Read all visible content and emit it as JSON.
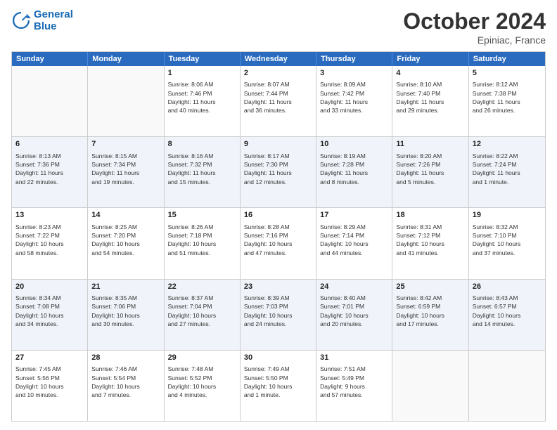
{
  "logo": {
    "line1": "General",
    "line2": "Blue"
  },
  "title": "October 2024",
  "location": "Epiniac, France",
  "header_days": [
    "Sunday",
    "Monday",
    "Tuesday",
    "Wednesday",
    "Thursday",
    "Friday",
    "Saturday"
  ],
  "rows": [
    [
      {
        "day": "",
        "lines": []
      },
      {
        "day": "",
        "lines": []
      },
      {
        "day": "1",
        "lines": [
          "Sunrise: 8:06 AM",
          "Sunset: 7:46 PM",
          "Daylight: 11 hours",
          "and 40 minutes."
        ]
      },
      {
        "day": "2",
        "lines": [
          "Sunrise: 8:07 AM",
          "Sunset: 7:44 PM",
          "Daylight: 11 hours",
          "and 36 minutes."
        ]
      },
      {
        "day": "3",
        "lines": [
          "Sunrise: 8:09 AM",
          "Sunset: 7:42 PM",
          "Daylight: 11 hours",
          "and 33 minutes."
        ]
      },
      {
        "day": "4",
        "lines": [
          "Sunrise: 8:10 AM",
          "Sunset: 7:40 PM",
          "Daylight: 11 hours",
          "and 29 minutes."
        ]
      },
      {
        "day": "5",
        "lines": [
          "Sunrise: 8:12 AM",
          "Sunset: 7:38 PM",
          "Daylight: 11 hours",
          "and 26 minutes."
        ]
      }
    ],
    [
      {
        "day": "6",
        "lines": [
          "Sunrise: 8:13 AM",
          "Sunset: 7:36 PM",
          "Daylight: 11 hours",
          "and 22 minutes."
        ]
      },
      {
        "day": "7",
        "lines": [
          "Sunrise: 8:15 AM",
          "Sunset: 7:34 PM",
          "Daylight: 11 hours",
          "and 19 minutes."
        ]
      },
      {
        "day": "8",
        "lines": [
          "Sunrise: 8:16 AM",
          "Sunset: 7:32 PM",
          "Daylight: 11 hours",
          "and 15 minutes."
        ]
      },
      {
        "day": "9",
        "lines": [
          "Sunrise: 8:17 AM",
          "Sunset: 7:30 PM",
          "Daylight: 11 hours",
          "and 12 minutes."
        ]
      },
      {
        "day": "10",
        "lines": [
          "Sunrise: 8:19 AM",
          "Sunset: 7:28 PM",
          "Daylight: 11 hours",
          "and 8 minutes."
        ]
      },
      {
        "day": "11",
        "lines": [
          "Sunrise: 8:20 AM",
          "Sunset: 7:26 PM",
          "Daylight: 11 hours",
          "and 5 minutes."
        ]
      },
      {
        "day": "12",
        "lines": [
          "Sunrise: 8:22 AM",
          "Sunset: 7:24 PM",
          "Daylight: 11 hours",
          "and 1 minute."
        ]
      }
    ],
    [
      {
        "day": "13",
        "lines": [
          "Sunrise: 8:23 AM",
          "Sunset: 7:22 PM",
          "Daylight: 10 hours",
          "and 58 minutes."
        ]
      },
      {
        "day": "14",
        "lines": [
          "Sunrise: 8:25 AM",
          "Sunset: 7:20 PM",
          "Daylight: 10 hours",
          "and 54 minutes."
        ]
      },
      {
        "day": "15",
        "lines": [
          "Sunrise: 8:26 AM",
          "Sunset: 7:18 PM",
          "Daylight: 10 hours",
          "and 51 minutes."
        ]
      },
      {
        "day": "16",
        "lines": [
          "Sunrise: 8:28 AM",
          "Sunset: 7:16 PM",
          "Daylight: 10 hours",
          "and 47 minutes."
        ]
      },
      {
        "day": "17",
        "lines": [
          "Sunrise: 8:29 AM",
          "Sunset: 7:14 PM",
          "Daylight: 10 hours",
          "and 44 minutes."
        ]
      },
      {
        "day": "18",
        "lines": [
          "Sunrise: 8:31 AM",
          "Sunset: 7:12 PM",
          "Daylight: 10 hours",
          "and 41 minutes."
        ]
      },
      {
        "day": "19",
        "lines": [
          "Sunrise: 8:32 AM",
          "Sunset: 7:10 PM",
          "Daylight: 10 hours",
          "and 37 minutes."
        ]
      }
    ],
    [
      {
        "day": "20",
        "lines": [
          "Sunrise: 8:34 AM",
          "Sunset: 7:08 PM",
          "Daylight: 10 hours",
          "and 34 minutes."
        ]
      },
      {
        "day": "21",
        "lines": [
          "Sunrise: 8:35 AM",
          "Sunset: 7:06 PM",
          "Daylight: 10 hours",
          "and 30 minutes."
        ]
      },
      {
        "day": "22",
        "lines": [
          "Sunrise: 8:37 AM",
          "Sunset: 7:04 PM",
          "Daylight: 10 hours",
          "and 27 minutes."
        ]
      },
      {
        "day": "23",
        "lines": [
          "Sunrise: 8:39 AM",
          "Sunset: 7:03 PM",
          "Daylight: 10 hours",
          "and 24 minutes."
        ]
      },
      {
        "day": "24",
        "lines": [
          "Sunrise: 8:40 AM",
          "Sunset: 7:01 PM",
          "Daylight: 10 hours",
          "and 20 minutes."
        ]
      },
      {
        "day": "25",
        "lines": [
          "Sunrise: 8:42 AM",
          "Sunset: 6:59 PM",
          "Daylight: 10 hours",
          "and 17 minutes."
        ]
      },
      {
        "day": "26",
        "lines": [
          "Sunrise: 8:43 AM",
          "Sunset: 6:57 PM",
          "Daylight: 10 hours",
          "and 14 minutes."
        ]
      }
    ],
    [
      {
        "day": "27",
        "lines": [
          "Sunrise: 7:45 AM",
          "Sunset: 5:56 PM",
          "Daylight: 10 hours",
          "and 10 minutes."
        ]
      },
      {
        "day": "28",
        "lines": [
          "Sunrise: 7:46 AM",
          "Sunset: 5:54 PM",
          "Daylight: 10 hours",
          "and 7 minutes."
        ]
      },
      {
        "day": "29",
        "lines": [
          "Sunrise: 7:48 AM",
          "Sunset: 5:52 PM",
          "Daylight: 10 hours",
          "and 4 minutes."
        ]
      },
      {
        "day": "30",
        "lines": [
          "Sunrise: 7:49 AM",
          "Sunset: 5:50 PM",
          "Daylight: 10 hours",
          "and 1 minute."
        ]
      },
      {
        "day": "31",
        "lines": [
          "Sunrise: 7:51 AM",
          "Sunset: 5:49 PM",
          "Daylight: 9 hours",
          "and 57 minutes."
        ]
      },
      {
        "day": "",
        "lines": []
      },
      {
        "day": "",
        "lines": []
      }
    ]
  ]
}
